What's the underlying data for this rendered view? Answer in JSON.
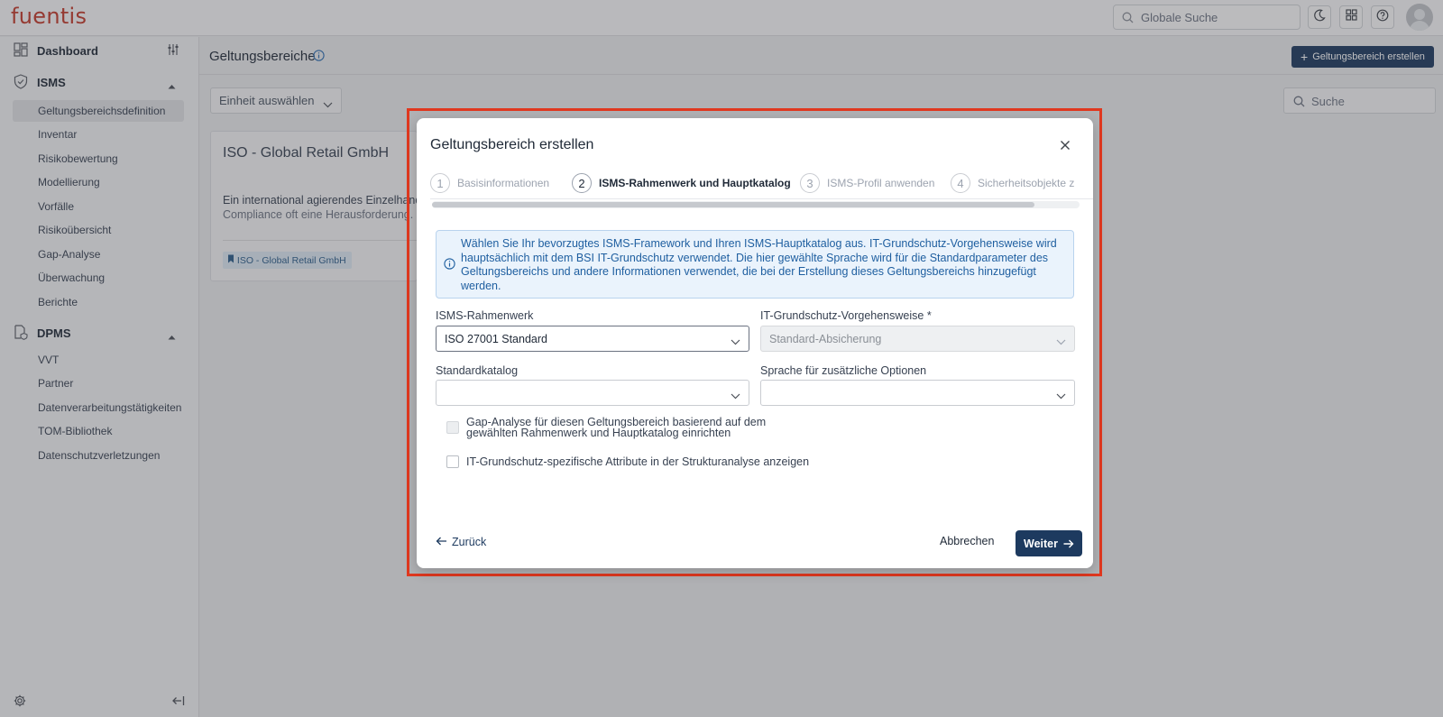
{
  "app": {
    "logo": "fuentis"
  },
  "topbar": {
    "search_placeholder": "Globale Suche",
    "icons": [
      "search-icon",
      "moon-icon",
      "apps-grid-icon",
      "help-icon",
      "avatar"
    ]
  },
  "sidebar": {
    "groups": [
      {
        "label": "Dashboard",
        "icon": "dashboard-icon"
      },
      {
        "label": "ISMS",
        "icon": "shield-icon",
        "expanded": true,
        "items": [
          "Geltungsbereichsdefinition",
          "Inventar",
          "Risikobewertung",
          "Modellierung",
          "Vorfälle",
          "Risikoübersicht",
          "Gap-Analyse",
          "Überwachung",
          "Berichte"
        ],
        "active": "Geltungsbereichsdefinition"
      },
      {
        "label": "DPMS",
        "icon": "document-icon",
        "expanded": true,
        "items": [
          "VVT",
          "Partner",
          "Datenverarbeitungstätigkeiten",
          "TOM-Bibliothek",
          "Datenschutzverletzungen"
        ]
      }
    ]
  },
  "main": {
    "title": "Geltungsbereiche",
    "create_button": "Geltungsbereich erstellen",
    "unit_select": "Einheit auswählen",
    "search_placeholder": "Suche",
    "card": {
      "title": "ISO - Global Retail GmbH",
      "desc_line1": "Ein international agierendes Einzelhand",
      "desc_line2": "Compliance oft eine Herausforderung. ",
      "tag": "ISO - Global Retail GmbH"
    }
  },
  "modal": {
    "title": "Geltungsbereich erstellen",
    "steps": [
      {
        "num": "1",
        "label": "Basisinformationen"
      },
      {
        "num": "2",
        "label": "ISMS-Rahmenwerk und Hauptkatalog"
      },
      {
        "num": "3",
        "label": "ISMS-Profil anwenden"
      },
      {
        "num": "4",
        "label": "Sicherheitsobjekte z"
      }
    ],
    "active_step": 2,
    "info": "Wählen Sie Ihr bevorzugtes ISMS-Framework und Ihren ISMS-Hauptkatalog aus. IT-Grundschutz-Vorgehensweise wird hauptsächlich mit dem BSI IT-Grundschutz verwendet. Die hier gewählte Sprache wird für die Standardparameter des Geltungsbereichs und andere Informationen verwendet, die bei der Erstellung dieses Geltungsbereichs hinzugefügt werden.",
    "fields": {
      "framework": {
        "label": "ISMS-Rahmenwerk",
        "value": "ISO 27001 Standard"
      },
      "approach": {
        "label": "IT-Grundschutz-Vorgehensweise *",
        "value": "Standard-Absicherung"
      },
      "catalog": {
        "label": "Standardkatalog",
        "value": ""
      },
      "language": {
        "label": "Sprache für zusätzliche Optionen",
        "value": ""
      }
    },
    "checkboxes": [
      {
        "line1": "Gap-Analyse für diesen Geltungsbereich basierend auf dem",
        "line2": "gewählten Rahmenwerk und Hauptkatalog einrichten",
        "disabled": true
      },
      {
        "line1": "IT-Grundschutz-spezifische Attribute in der Strukturanalyse anzeigen",
        "disabled": false
      }
    ],
    "back": "Zurück",
    "cancel": "Abbrechen",
    "next": "Weiter"
  },
  "colors": {
    "primary": "#1d3a5f",
    "highlight": "#e0381f",
    "info_text": "#1f5fa0",
    "logo": "#c0392b"
  }
}
